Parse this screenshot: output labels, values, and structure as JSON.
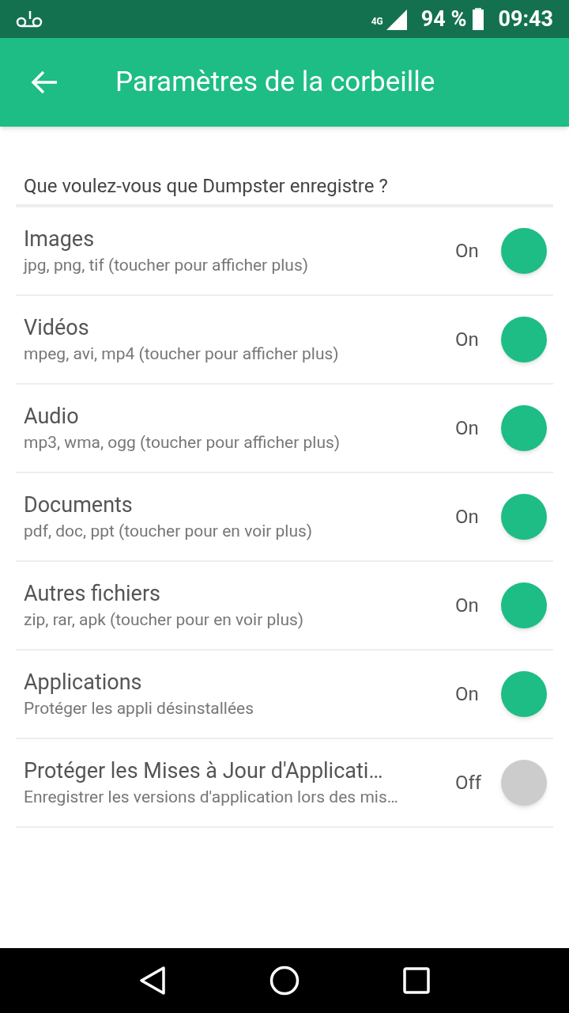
{
  "status_bar": {
    "network": "4G",
    "battery": "94 %",
    "time": "09:43"
  },
  "app_bar": {
    "title": "Paramètres de la corbeille"
  },
  "section": {
    "title": "Que voulez-vous que Dumpster enregistre ?"
  },
  "settings": [
    {
      "title": "Images",
      "subtitle": "jpg, png, tif (toucher pour afficher plus)",
      "state_label": "On",
      "on": true
    },
    {
      "title": "Vidéos",
      "subtitle": "mpeg, avi, mp4 (toucher pour afficher plus)",
      "state_label": "On",
      "on": true
    },
    {
      "title": "Audio",
      "subtitle": "mp3, wma, ogg (toucher pour afficher plus)",
      "state_label": "On",
      "on": true
    },
    {
      "title": "Documents",
      "subtitle": "pdf, doc, ppt (toucher pour en voir plus)",
      "state_label": "On",
      "on": true
    },
    {
      "title": "Autres fichiers",
      "subtitle": "zip, rar, apk (toucher pour en voir plus)",
      "state_label": "On",
      "on": true
    },
    {
      "title": "Applications",
      "subtitle": "Protéger les appli désinstallées",
      "state_label": "On",
      "on": true
    },
    {
      "title": "Protéger les Mises à Jour d'Applicati…",
      "subtitle": "Enregistrer les versions d'application lors des mis…",
      "state_label": "Off",
      "on": false
    }
  ]
}
